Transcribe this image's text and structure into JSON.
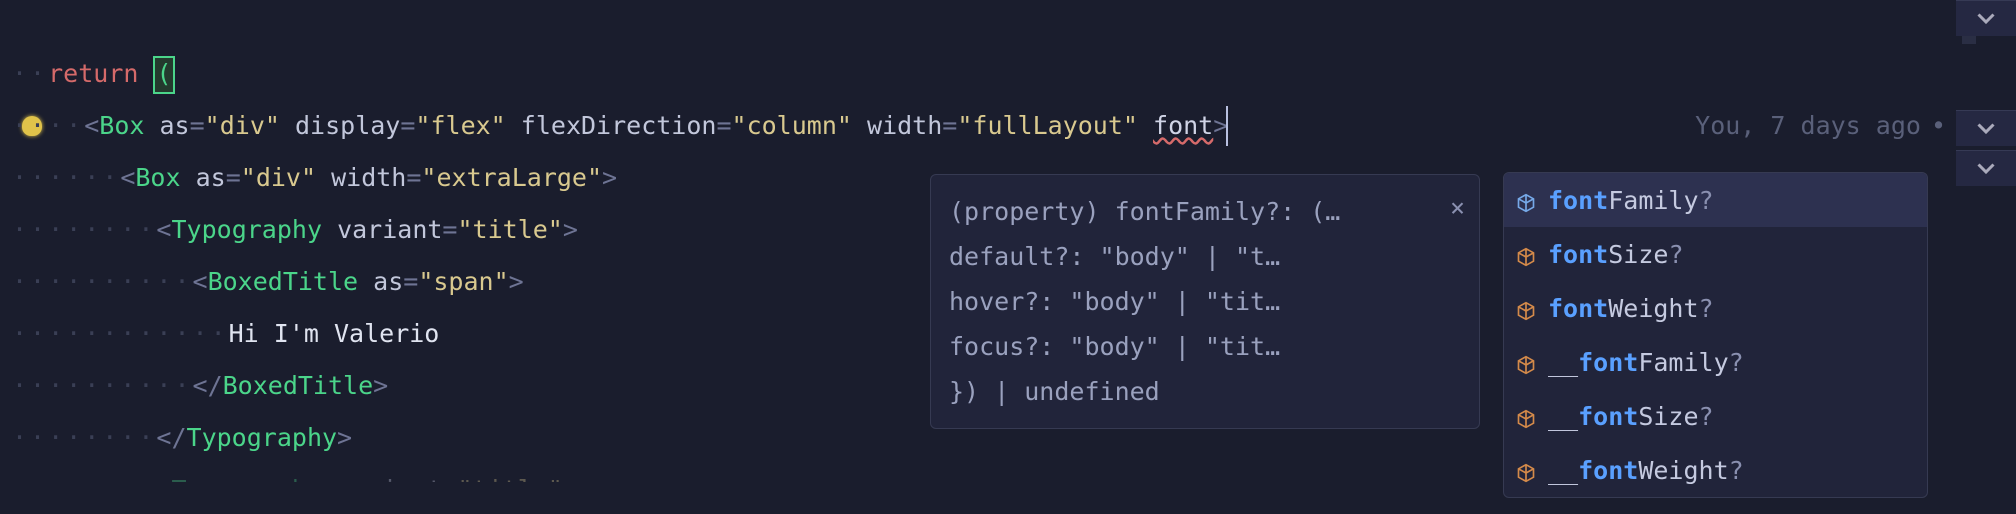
{
  "blame": "You, 7 days ago",
  "code": {
    "l1_return": "return",
    "l2_tag": "Box",
    "l2_as": "as",
    "l2_as_v": "\"div\"",
    "l2_display": "display",
    "l2_display_v": "\"flex\"",
    "l2_flexdir": "flexDirection",
    "l2_flexdir_v": "\"column\"",
    "l2_width": "width",
    "l2_width_v": "\"fullLayout\"",
    "l2_font": "font",
    "l3_tag": "Box",
    "l3_as": "as",
    "l3_as_v": "\"div\"",
    "l3_width": "width",
    "l3_width_v": "\"extraLarge\"",
    "l4_tag": "Typography",
    "l4_variant": "variant",
    "l4_variant_v": "\"title\"",
    "l5_tag": "BoxedTitle",
    "l5_as": "as",
    "l5_as_v": "\"span\"",
    "l6_text": "Hi I'm Valerio",
    "l7_close": "BoxedTitle",
    "l8_close": "Typography",
    "l9_tag_partial": "Typography",
    "l9_variant": "variant",
    "l9_variant_v": "\"title\""
  },
  "signature": {
    "l1": "(property) fontFamily?: (…",
    "l2": "  default?: \"body\" | \"t…",
    "l3": "  hover?: \"body\" | \"tit…",
    "l4": "  focus?: \"body\" | \"tit…",
    "l5": "}) | undefined"
  },
  "suggest_match": "font",
  "suggest": [
    {
      "rest": "Family",
      "q": "?",
      "prefix": "",
      "selected": true
    },
    {
      "rest": "Size",
      "q": "?",
      "prefix": "",
      "selected": false
    },
    {
      "rest": "Weight",
      "q": "?",
      "prefix": "",
      "selected": false
    },
    {
      "rest": "Family",
      "q": "?",
      "prefix": "__",
      "selected": false
    },
    {
      "rest": "Size",
      "q": "?",
      "prefix": "__",
      "selected": false
    },
    {
      "rest": "Weight",
      "q": "?",
      "prefix": "__",
      "selected": false
    }
  ]
}
